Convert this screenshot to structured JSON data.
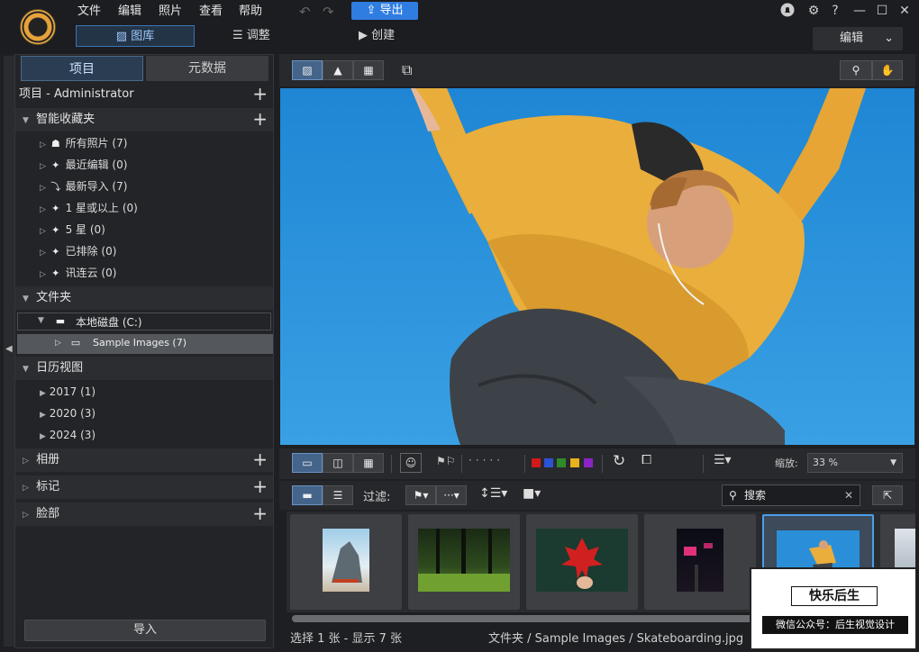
{
  "menu": [
    "文件",
    "编辑",
    "照片",
    "查看",
    "帮助"
  ],
  "export_label": "导出",
  "modes": {
    "library": "图库",
    "adjust": "调整",
    "create": "创建"
  },
  "edit_dropdown": "编辑",
  "panel_tabs": {
    "projects": "项目",
    "metadata": "元数据"
  },
  "project_title": "项目 - Administrator",
  "smart_collections": {
    "title": "智能收藏夹",
    "items": [
      "所有照片 (7)",
      "最近编辑 (0)",
      "最新导入 (7)",
      "1 星或以上 (0)",
      "5 星 (0)",
      "已排除 (0)",
      "讯连云 (0)"
    ]
  },
  "folders": {
    "title": "文件夹",
    "drive": "本地磁盘 (C:)",
    "sample": "Sample Images (7)"
  },
  "calendar": {
    "title": "日历视图",
    "years": [
      "2017 (1)",
      "2020 (3)",
      "2024 (3)"
    ]
  },
  "albums_title": "相册",
  "tags_title": "标记",
  "faces_title": "脸部",
  "import_label": "导入",
  "zoom": {
    "label": "缩放:",
    "value": "33 %"
  },
  "filter_label": "过滤:",
  "search_placeholder": "搜索",
  "status": {
    "selection": "选择 1 张 - 显示 7 张",
    "path": "文件夹 / Sample Images / Skateboarding.jpg"
  },
  "watermark": {
    "title": "快乐后生",
    "subtitle": "微信公众号：后生视觉设计"
  },
  "colors": {
    "accent": "#2f7de1",
    "selected_border": "#4a9eea",
    "swatches": [
      "#d11a1a",
      "#2d52d6",
      "#2f8a2a",
      "#e8b21c",
      "#8a24c6"
    ]
  },
  "thumbnails": [
    "rock-boat",
    "forest",
    "red-maple-leaf",
    "neon-street",
    "skateboarding"
  ]
}
